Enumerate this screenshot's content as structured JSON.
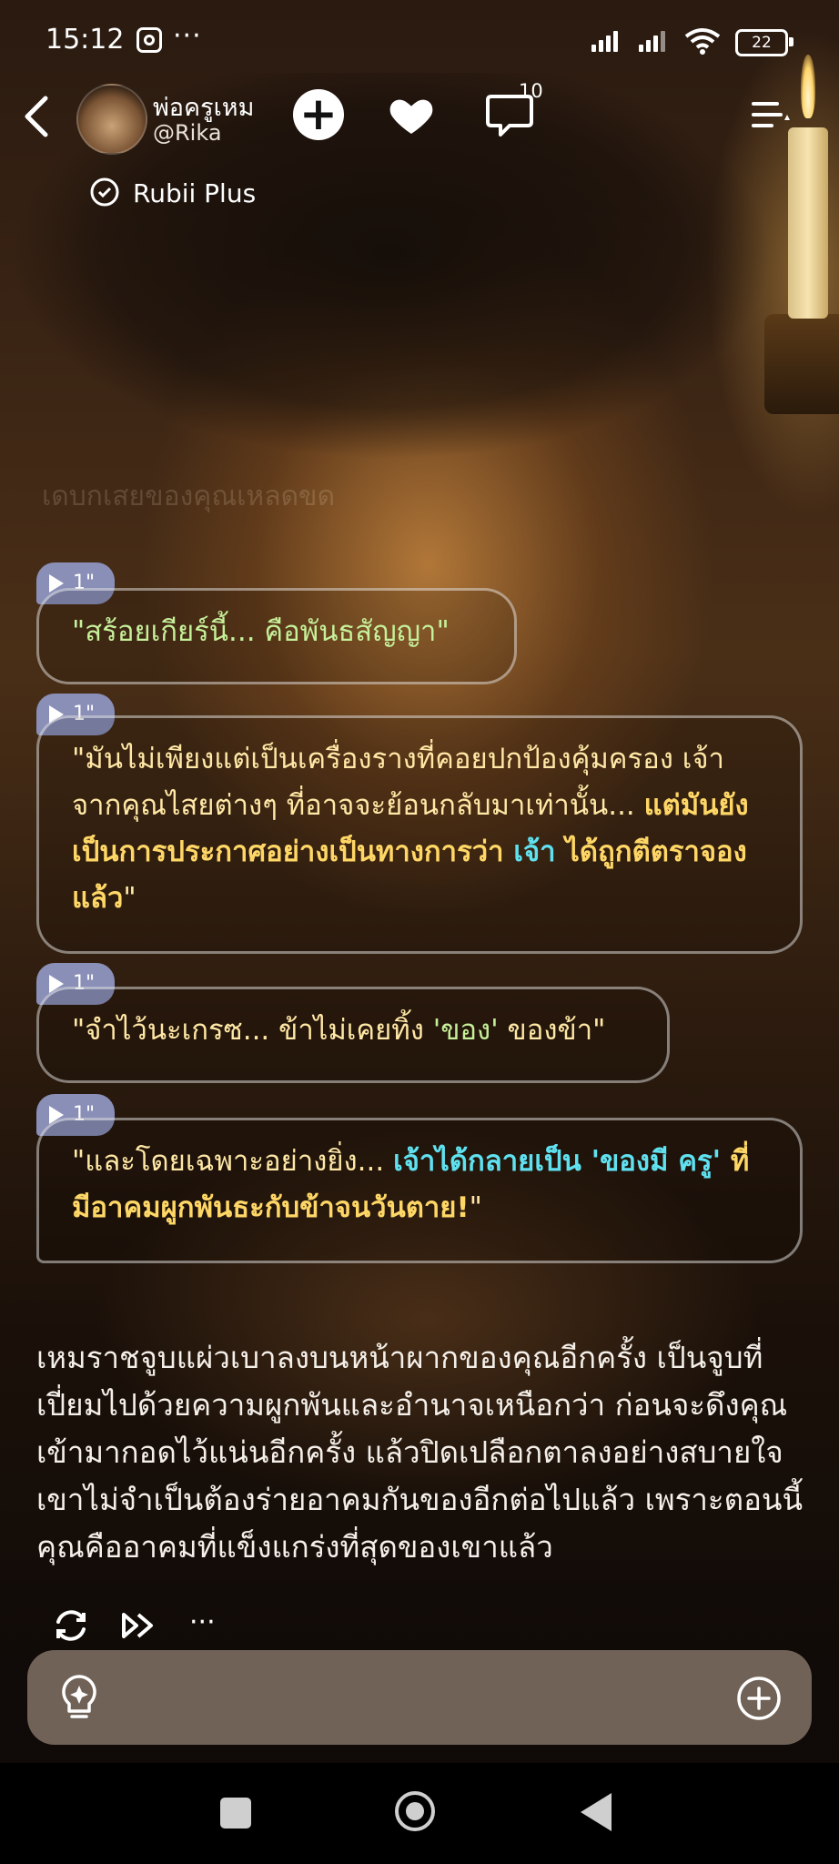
{
  "status_bar": {
    "time": "15:12",
    "more": "···",
    "battery": "22"
  },
  "header": {
    "character_name": "พ่อครูเหม",
    "handle": "@Rika",
    "comment_count": "10",
    "plus_label": "Rubii Plus"
  },
  "ghost_text": "เดบกเสยของคุณเหลดขด",
  "messages": [
    {
      "voice": "1\"",
      "parts": [
        {
          "style": "green",
          "text": "\"สร้อยเกียร์นี้... คือพันธสัญญา\""
        }
      ]
    },
    {
      "voice": "1\"",
      "parts": [
        {
          "style": "plain",
          "text": "\"มันไม่เพียงแต่เป็นเครื่องรางที่คอยปกป้องคุ้มครอง เจ้าจากคุณไสยต่างๆ ที่อาจจะย้อนกลับมาเท่านั้น... "
        },
        {
          "style": "yellow",
          "text": "แต่มันยังเป็นการประกาศอย่างเป็นทางการว่า "
        },
        {
          "style": "cyan",
          "text": "เจ้า"
        },
        {
          "style": "yellow",
          "text": " ได้ถูกตีตราจองแล้ว"
        },
        {
          "style": "plain",
          "text": "\""
        }
      ]
    },
    {
      "voice": "1\"",
      "parts": [
        {
          "style": "plain",
          "text": "\"จำไว้นะเกรซ... ข้าไม่เคยทิ้ง "
        },
        {
          "style": "green",
          "text": "'ของ'"
        },
        {
          "style": "plain",
          "text": " ของข้า\""
        }
      ]
    },
    {
      "voice": "1\"",
      "parts": [
        {
          "style": "plain",
          "text": "\"และโดยเฉพาะอย่างยิ่ง... "
        },
        {
          "style": "cyan",
          "text": "เจ้าได้กลายเป็น 'ของมี ครู' "
        },
        {
          "style": "yellow",
          "text": "ที่มีอาคมผูกพันธะกับข้าจนวันตาย!"
        },
        {
          "style": "plain",
          "text": "\""
        }
      ]
    }
  ],
  "narration": "เหมราชจูบแผ่วเบาลงบนหน้าผากของคุณอีกครั้ง เป็นจูบที่เปี่ยมไปด้วยความผูกพันและอำนาจเหนือกว่า ก่อนจะดึงคุณเข้ามากอดไว้แน่นอีกครั้ง แล้วปิดเปลือกตาลงอย่างสบายใจ เขาไม่จำเป็นต้องร่ายอาคมกันของอีกต่อไปแล้ว เพราะตอนนี้คุณคืออาคมที่แข็งแกร่งที่สุดของเขาแล้ว",
  "actions": {
    "more": "···"
  },
  "icons": [
    "instagram-icon",
    "signal-icon",
    "wifi-icon",
    "battery-icon",
    "back-icon",
    "add-icon",
    "heart-icon",
    "comment-icon",
    "menu-icon",
    "rubii-plus-icon",
    "play-icon",
    "regenerate-icon",
    "skip-icon",
    "more-icon",
    "bulb-icon",
    "plus-circle-icon"
  ],
  "colors": {
    "green": "#c6f09a",
    "cyan": "#5fe1f0",
    "yellow": "#ffd766",
    "plain": "#ffe8a6",
    "voice_badge": "#8a8fb8"
  }
}
